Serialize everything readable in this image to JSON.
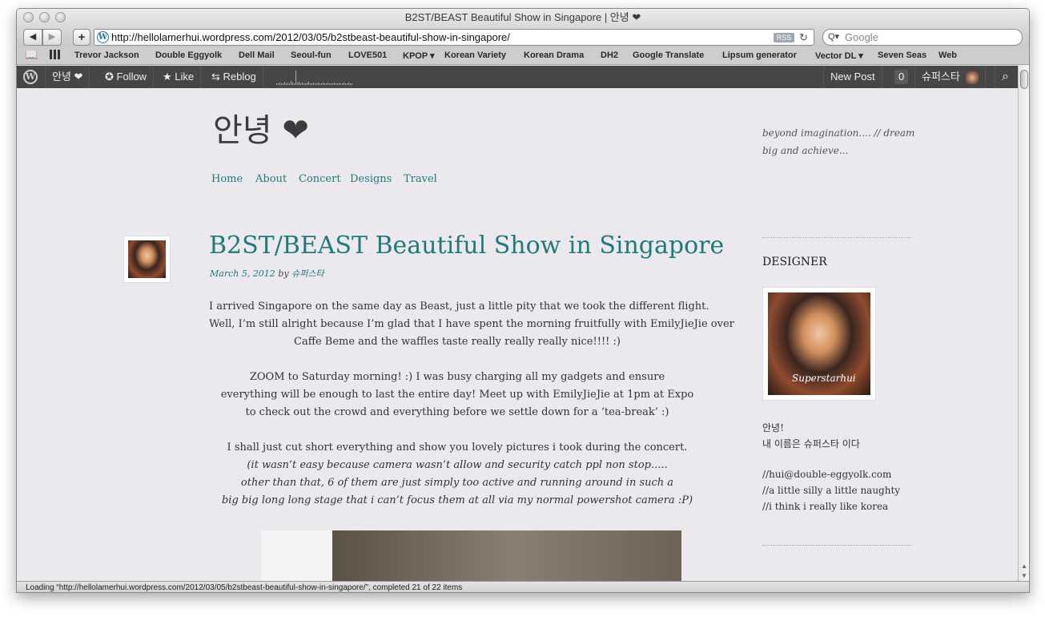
{
  "window": {
    "title": "B2ST/BEAST Beautiful Show in Singapore | 안녕 ❤"
  },
  "toolbar": {
    "back_glyph": "◀",
    "forward_glyph": "▶",
    "add_glyph": "+",
    "url": "http://hellolamerhui.wordpress.com/2012/03/05/b2stbeast-beautiful-show-in-singapore/",
    "rss_label": "RSS",
    "reload_glyph": "↻",
    "search_placeholder": "Google",
    "search_glyph": "Q▾"
  },
  "bookmarks": {
    "items": [
      "Trevor Jackson",
      "Double Eggyolk",
      "Dell Mail",
      "Seoul-fun",
      "LOVE501",
      "KPOP ▾",
      "Korean Variety",
      "Korean Drama",
      "DH2",
      "Google Translate",
      "Lipsum generator",
      "Vector DL ▾",
      "Seven Seas",
      "Web"
    ]
  },
  "wpbar": {
    "logo": "W",
    "site": "안녕 ❤",
    "follow": "✪ Follow",
    "like": "★ Like",
    "reblog": "⇆ Reblog",
    "new_post": "New Post",
    "notifications": "0",
    "user": "슈퍼스타",
    "search_glyph": "⌕",
    "sparkline": [
      2,
      2,
      3,
      2,
      2,
      4,
      2,
      3,
      2,
      5,
      3,
      2,
      18,
      3,
      4,
      2,
      3,
      2,
      2,
      3,
      4,
      2,
      2,
      3,
      2,
      2,
      3,
      2,
      2,
      3,
      2,
      2,
      3,
      2,
      2,
      2,
      3,
      2,
      2,
      3,
      2,
      2,
      3,
      2,
      2,
      3,
      2,
      2
    ]
  },
  "site": {
    "title": "안녕 ❤",
    "tagline": "beyond imagination.... // dream big and achieve...",
    "menu": [
      "Home",
      "About",
      "Concert",
      "Designs",
      "Travel"
    ]
  },
  "post": {
    "title": "B2ST/BEAST Beautiful Show in Singapore",
    "date": "March 5, 2012",
    "by": "by",
    "author": "슈퍼스타",
    "lines": [
      "I arrived Singapore on the same day as Beast, just a little pity that we took the different flight.",
      "Well, I’m still alright because I’m glad that I have spent the morning fruitfully with EmilyJieJie over",
      "Caffe Beme and the waffles taste really really really nice!!!! :)",
      "ZOOM to Saturday morning! :) I was busy charging all my gadgets and ensure",
      "everything will be enough to last the entire day! Meet up with EmilyJieJie at 1pm at Expo",
      "to check out the crowd and everything before we settle down for a ‘tea-break’ :)",
      "I shall just cut short everything and show you lovely pictures i took during the concert.",
      "(it wasn’t easy because camera wasn’t allow and security catch ppl non stop.....",
      "other than that, 6 of them are just simply too active and running around in such a",
      "big big long long stage that i can’t focus them at all via my normal powershot camera :P)"
    ]
  },
  "sidebar": {
    "heading": "DESIGNER",
    "image_caption": "Superstarhui",
    "lines": [
      "안녕!",
      "내 이름은 슈퍼스타 이다",
      "//hui@double-eggyolk.com",
      "//a little silly a little naughty",
      "//i think i really like korea"
    ]
  },
  "status": {
    "text": "Loading “http://hellolamerhui.wordpress.com/2012/03/05/b2stbeast-beautiful-show-in-singapore/”, completed 21 of 22 items"
  }
}
